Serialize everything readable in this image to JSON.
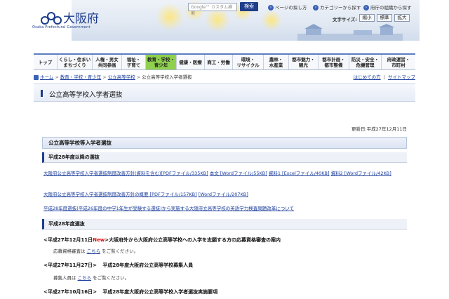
{
  "header": {
    "logo_text": "大阪府",
    "logo_en": "Osaka Prefectural Government",
    "search_placeholder": "Google™ カスタム検索",
    "search_button": "検索",
    "top_links": [
      "ページの探し方",
      "カテゴリーから探す",
      "府庁の組織から探す"
    ],
    "font_size_label": "文字サイズ:",
    "font_sizes": [
      "縮小",
      "標準",
      "拡大"
    ]
  },
  "nav": {
    "items": [
      {
        "label": "トップ"
      },
      {
        "label": "くらし・住まい\nまちづくり"
      },
      {
        "label": "人権・男女\n共同参画"
      },
      {
        "label": "福祉・\n子育て"
      },
      {
        "label": "教育・学校・\n青少年",
        "active": true
      },
      {
        "label": "健康・医療"
      },
      {
        "label": "商工・労働"
      },
      {
        "label": "環境・\nリサイクル"
      },
      {
        "label": "農林・\n水産業"
      },
      {
        "label": "都市魅力・\n観光"
      },
      {
        "label": "都市計画・\n都市整備"
      },
      {
        "label": "防災・安全・\n危機管理"
      },
      {
        "label": "府政運営・\n市町村"
      }
    ]
  },
  "breadcrumb": {
    "items": [
      "ホーム",
      "教育・学校・青少年",
      "公立高等学校",
      "公立高等学校入学者選抜"
    ],
    "right_links": [
      "はじめての方",
      "サイトマップ"
    ]
  },
  "page": {
    "title": "公立高等学校入学者選抜",
    "updated": "更新日:平成27年12月11日",
    "section_title": "公立高等学校等入学者選抜",
    "subhead_1": "平成28年度以降の選抜",
    "link_row_1": {
      "a": "大阪府公立高等学校入学者選抜制度改善方針(資料を含む)[PDFファイル/335KB]",
      "b": "本文 [Wordファイル/55KB]",
      "c": "資料1 [Excelファイル/40KB]",
      "d": "資料2 [Wordファイル/42KB]"
    },
    "link_row_2": {
      "a": "大阪府公立高等学校入学者選抜制度改善方針の概要 [PDFファイル/157KB]",
      "b": "[Wordファイル/207KB]"
    },
    "link_row_3": "平成28年度選抜(平成26年度の中学1年生が受験する選抜)から実施する大阪府立高等学校の英語学力検査問題改革について",
    "subhead_2": "平成28年度選抜",
    "entries": [
      {
        "date": "<平成27年12月11日",
        "new": "New",
        "text": ">大阪府外から大阪府公立高等学校への入学を志願する方の応募資格審査の案内",
        "detail_prefix": "応募資格審査は",
        "detail_link": "こちら",
        "detail_suffix": "をご覧ください。"
      },
      {
        "date": "<平成27年11月27日>",
        "text": "平成28年度大阪府公立高等学校募集人員",
        "detail_prefix": "募集人員は",
        "detail_link": "こちら",
        "detail_suffix": "をご覧ください。"
      },
      {
        "date": "<平成27年10月16日>",
        "text": "平成28年度大阪府公立高等学校入学者選抜実施要項"
      }
    ]
  }
}
